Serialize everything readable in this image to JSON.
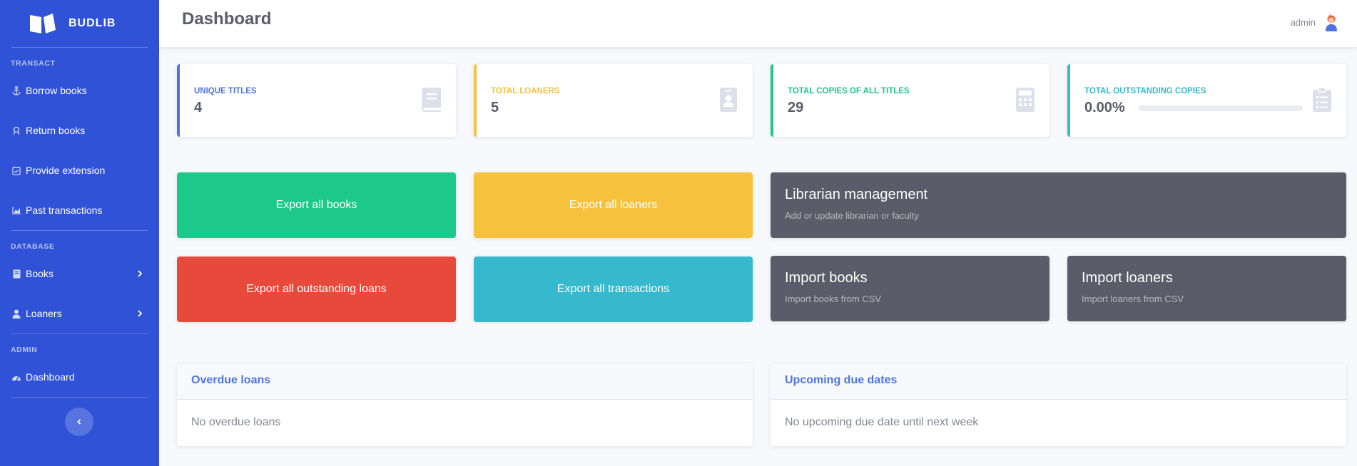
{
  "brand": {
    "name": "BUDLIB"
  },
  "sidebar": {
    "sections": {
      "transact": "TRANSACT",
      "database": "DATABASE",
      "admin": "ADMIN"
    },
    "items": [
      {
        "label": "Borrow books",
        "icon": "anchor-icon"
      },
      {
        "label": "Return books",
        "icon": "user-circle-icon"
      },
      {
        "label": "Provide extension",
        "icon": "calendar-check-icon"
      },
      {
        "label": "Past transactions",
        "icon": "chart-area-icon"
      },
      {
        "label": "Books",
        "icon": "book-icon"
      },
      {
        "label": "Loaners",
        "icon": "user-icon"
      },
      {
        "label": "Dashboard",
        "icon": "tachometer-icon"
      }
    ]
  },
  "topbar": {
    "title": "Dashboard",
    "user": "admin"
  },
  "stats": [
    {
      "label": "UNIQUE TITLES",
      "value": "4",
      "color": "#4e73df",
      "icon": "book-icon"
    },
    {
      "label": "TOTAL LOANERS",
      "value": "5",
      "color": "#f6c23e",
      "icon": "id-badge-icon"
    },
    {
      "label": "TOTAL COPIES OF ALL TITLES",
      "value": "29",
      "color": "#1cc88a",
      "icon": "calculator-icon"
    },
    {
      "label": "TOTAL OUTSTANDING COPIES",
      "value": "0.00%",
      "color": "#36b9cc",
      "icon": "clipboard-list-icon",
      "progress": 0
    }
  ],
  "actions": [
    {
      "label": "Export all books",
      "color": "#1cc88a"
    },
    {
      "label": "Export all loaners",
      "color": "#f6c23e"
    },
    {
      "label": "Export all outstanding loans",
      "color": "#e74a3b"
    },
    {
      "label": "Export all transactions",
      "color": "#36b9cc"
    }
  ],
  "management": [
    {
      "title": "Librarian management",
      "subtitle": "Add or update librarian or faculty"
    },
    {
      "title": "Import books",
      "subtitle": "Import books from CSV"
    },
    {
      "title": "Import loaners",
      "subtitle": "Import loaners from CSV"
    }
  ],
  "panels": [
    {
      "title": "Overdue loans",
      "body": "No overdue loans"
    },
    {
      "title": "Upcoming due dates",
      "body": "No upcoming due date until next week"
    }
  ]
}
